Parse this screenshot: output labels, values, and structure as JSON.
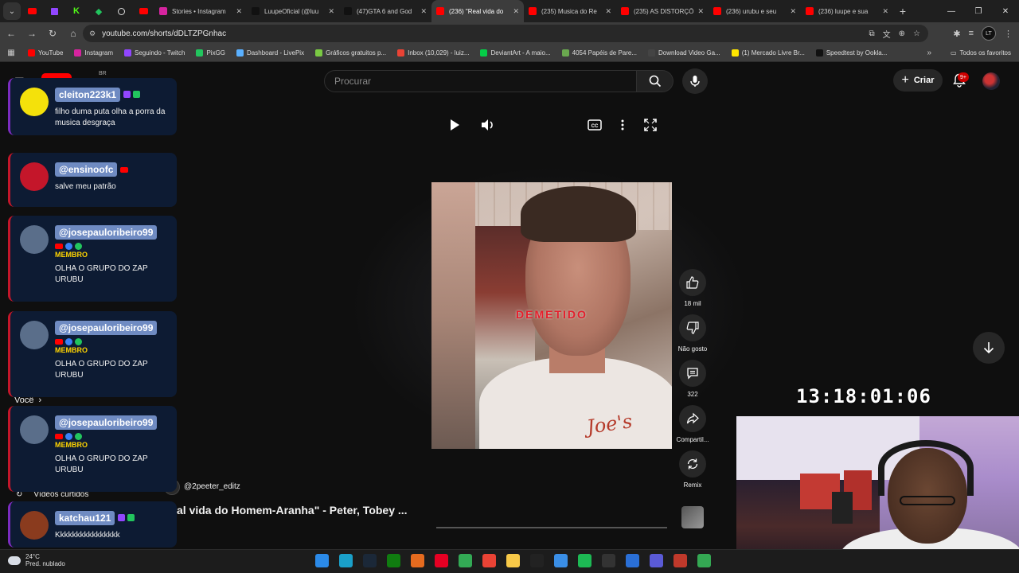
{
  "browser": {
    "tabs": [
      {
        "title": "Stories • Instagram",
        "favicon": "instagram-icon",
        "color": "#d6249f"
      },
      {
        "title": "LuupeOficial (@luu",
        "favicon": "tiktok-icon",
        "color": "#111111"
      },
      {
        "title": "(47)GTA 6 and God",
        "favicon": "tiktok-icon",
        "color": "#111111"
      },
      {
        "title": "(236) \"Real vida do",
        "favicon": "youtube-icon",
        "color": "#ff0000",
        "active": true
      },
      {
        "title": "(235) Musica do Re",
        "favicon": "youtube-icon",
        "color": "#ff0000"
      },
      {
        "title": "(235) AS DISTORÇÕ",
        "favicon": "youtube-icon",
        "color": "#ff0000"
      },
      {
        "title": "(236) urubu e seu",
        "favicon": "youtube-icon",
        "color": "#ff0000"
      },
      {
        "title": "(236) luupe e sua",
        "favicon": "youtube-icon",
        "color": "#ff0000"
      }
    ],
    "url": "youtube.com/shorts/dDLTZPGnhac",
    "bookmarks": [
      {
        "label": "YouTube",
        "color": "#ff0000"
      },
      {
        "label": "Instagram",
        "color": "#d6249f"
      },
      {
        "label": "Seguindo - Twitch",
        "color": "#9146ff"
      },
      {
        "label": "PixGG",
        "color": "#22c55e"
      },
      {
        "label": "Dashboard - LivePix",
        "color": "#5ab0ff"
      },
      {
        "label": "Gráficos gratuitos p...",
        "color": "#7ac943"
      },
      {
        "label": "Inbox (10,029) - luiz...",
        "color": "#ea4335"
      },
      {
        "label": "DeviantArt - A maio...",
        "color": "#05cc47"
      },
      {
        "label": "4054 Papéis de Pare...",
        "color": "#6aa84f"
      },
      {
        "label": "Download Video Ga...",
        "color": "#444444"
      },
      {
        "label": "(1) Mercado Livre Br...",
        "color": "#ffe600"
      },
      {
        "label": "Speedtest by Ookla...",
        "color": "#111111"
      }
    ],
    "all_bookmarks": "Todos os favoritos"
  },
  "youtube": {
    "country": "BR",
    "search_placeholder": "Procurar",
    "create_label": "Criar",
    "notif_badge": "9+",
    "short": {
      "caption": "DEMETIDO",
      "channel": "@2peeter_editz",
      "title": "al vida do Homem-Aranha\" - Peter, Tobey ...",
      "progress": 0.0,
      "likes": "18 mil",
      "dislike_label": "Não gosto",
      "comments": "322",
      "share_label": "Compartil...",
      "remix_label": "Remix"
    },
    "sidebar": {
      "voce": "Você",
      "liked": "Vídeos curtidos"
    }
  },
  "overlay": {
    "clock": "13:18:01:06",
    "chat": [
      {
        "name": "cleiton223k1",
        "platform": "twitch",
        "avatar_color": "#f4e10b",
        "member": "",
        "text": "filho duma puta olha a porra da musica desgraça"
      },
      {
        "name": "@ensinoofc",
        "platform": "youtube",
        "avatar_color": "#c4162a",
        "member": "",
        "text": "salve meu patrão"
      },
      {
        "name": "@josepauloribeiro99",
        "platform": "youtube",
        "avatar_color": "#5a6e8a",
        "member": "MEMBRO",
        "text": "OLHA O GRUPO DO ZAP URUBU"
      },
      {
        "name": "@josepauloribeiro99",
        "platform": "youtube",
        "avatar_color": "#5a6e8a",
        "member": "MEMBRO",
        "text": "OLHA O GRUPO DO ZAP URUBU"
      },
      {
        "name": "@josepauloribeiro99",
        "platform": "youtube",
        "avatar_color": "#5a6e8a",
        "member": "MEMBRO",
        "text": "OLHA O GRUPO DO ZAP URUBU"
      },
      {
        "name": "katchau121",
        "platform": "twitch",
        "avatar_color": "#8a3b1e",
        "member": "",
        "text": "Kkkkkkkkkkkkkkkk"
      }
    ]
  },
  "taskbar": {
    "weather_temp": "24°C",
    "weather_desc": "Pred. nublado",
    "apps": [
      {
        "name": "windows-start",
        "color": "#2b8ae8"
      },
      {
        "name": "edge",
        "color": "#1aa0c9"
      },
      {
        "name": "steam",
        "color": "#1b2838"
      },
      {
        "name": "xbox",
        "color": "#107c10"
      },
      {
        "name": "affinity",
        "color": "#e56b1f"
      },
      {
        "name": "pinterest",
        "color": "#e60023"
      },
      {
        "name": "b-app",
        "color": "#33aa55"
      },
      {
        "name": "chrome",
        "color": "#ea4335"
      },
      {
        "name": "file-explorer",
        "color": "#f7c948"
      },
      {
        "name": "capcut",
        "color": "#222222"
      },
      {
        "name": "notepad",
        "color": "#3a8ee6"
      },
      {
        "name": "spotify",
        "color": "#1db954"
      },
      {
        "name": "obs",
        "color": "#333333"
      },
      {
        "name": "app-blue",
        "color": "#2a6fd6"
      },
      {
        "name": "app-multi",
        "color": "#5a5ad6"
      },
      {
        "name": "app-red",
        "color": "#c0392b"
      },
      {
        "name": "chrome-2",
        "color": "#34a853"
      }
    ]
  }
}
